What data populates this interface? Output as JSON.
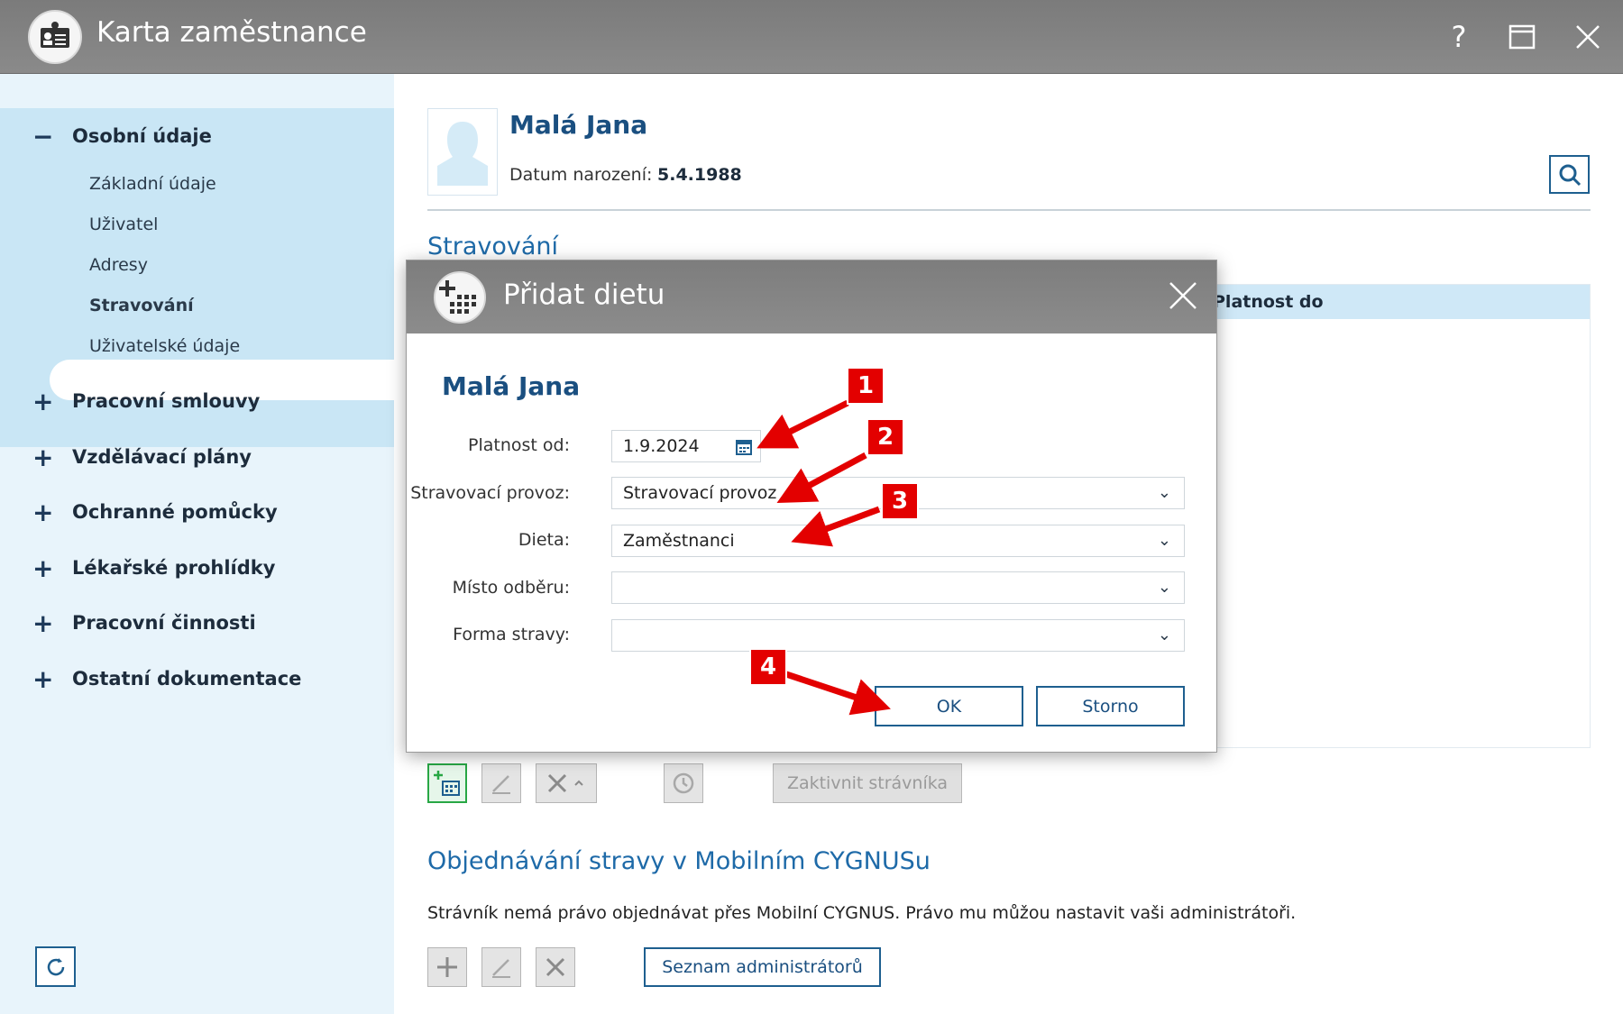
{
  "window": {
    "title": "Karta zaměstnance",
    "help": "?",
    "maximize": "☐",
    "close": "✕"
  },
  "sidebar": {
    "groups": [
      {
        "sign": "−",
        "label": "Osobní údaje"
      },
      {
        "sign": "+",
        "label": "Pracovní smlouvy"
      },
      {
        "sign": "+",
        "label": "Vzdělávací plány"
      },
      {
        "sign": "+",
        "label": "Ochranné pomůcky"
      },
      {
        "sign": "+",
        "label": "Lékařské prohlídky"
      },
      {
        "sign": "+",
        "label": "Pracovní činnosti"
      },
      {
        "sign": "+",
        "label": "Ostatní dokumentace"
      }
    ],
    "subitems": [
      "Základní údaje",
      "Uživatel",
      "Adresy",
      "Stravování",
      "Uživatelské údaje"
    ],
    "active_subitem": "Stravování"
  },
  "employee": {
    "name": "Malá Jana",
    "dob_label": "Datum narození:",
    "dob_value": "5.4.1988"
  },
  "section": {
    "title": "Stravování",
    "column_platnost_do": "Platnost do"
  },
  "toolbar": {
    "activate_label": "Zaktivnit strávníka"
  },
  "mobile": {
    "title": "Objednávání stravy v Mobilním CYGNUSu",
    "info": "Strávník nemá právo objednávat přes Mobilní CYGNUS. Právo mu můžou nastavit vaši administrátoři.",
    "admins_button": "Seznam administrátorů"
  },
  "modal": {
    "title": "Přidat dietu",
    "employee_name": "Malá Jana",
    "fields": {
      "platnost_od_label": "Platnost od:",
      "platnost_od_value": "1.9.2024",
      "provoz_label": "Stravovací provoz:",
      "provoz_value": "Stravovací provoz",
      "dieta_label": "Dieta:",
      "dieta_value": "Zaměstnanci",
      "misto_label": "Místo odběru:",
      "misto_value": "",
      "forma_label": "Forma stravy:",
      "forma_value": ""
    },
    "ok_label": "OK",
    "cancel_label": "Storno"
  },
  "annotations": [
    "1",
    "2",
    "3",
    "4"
  ],
  "colors": {
    "annotation": "#e30000",
    "accent": "#1e5f8f",
    "sidebar_active_bg": "#c9e6f5"
  }
}
